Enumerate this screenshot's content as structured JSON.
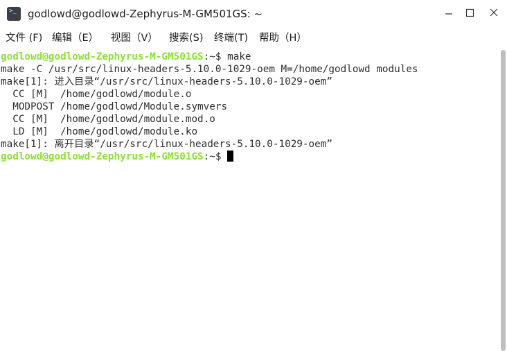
{
  "window": {
    "title": "godlowd@godlowd-Zephyrus-M-GM501GS: ~",
    "icon": "terminal-icon"
  },
  "menu": {
    "items": [
      {
        "label": "文件 (F)"
      },
      {
        "label": "编辑（E）"
      },
      {
        "label": "视图（V）"
      },
      {
        "label": "搜索(S)"
      },
      {
        "label": "终端(T)"
      },
      {
        "label": "帮助（H）"
      }
    ]
  },
  "terminal": {
    "prompt_user": "godlowd@godlowd-Zephyrus-M-GM501GS",
    "prompt_suffix": ":~$ ",
    "lines": [
      {
        "text": "make"
      },
      {
        "text": "make -C /usr/src/linux-headers-5.10.0-1029-oem M=/home/godlowd modules"
      },
      {
        "text": "make[1]: 进入目录“/usr/src/linux-headers-5.10.0-1029-oem”"
      },
      {
        "text": "  CC [M]  /home/godlowd/module.o"
      },
      {
        "text": "  MODPOST /home/godlowd/Module.symvers"
      },
      {
        "text": "  CC [M]  /home/godlowd/module.mod.o"
      },
      {
        "text": "  LD [M]  /home/godlowd/module.ko"
      },
      {
        "text": "make[1]: 离开目录“/usr/src/linux-headers-5.10.0-1029-oem”"
      },
      {
        "text": ""
      }
    ]
  },
  "colors": {
    "prompt_user": "#8ae234",
    "text": "#2e2e2e",
    "background": "#ffffff",
    "cursor": "#000000"
  }
}
